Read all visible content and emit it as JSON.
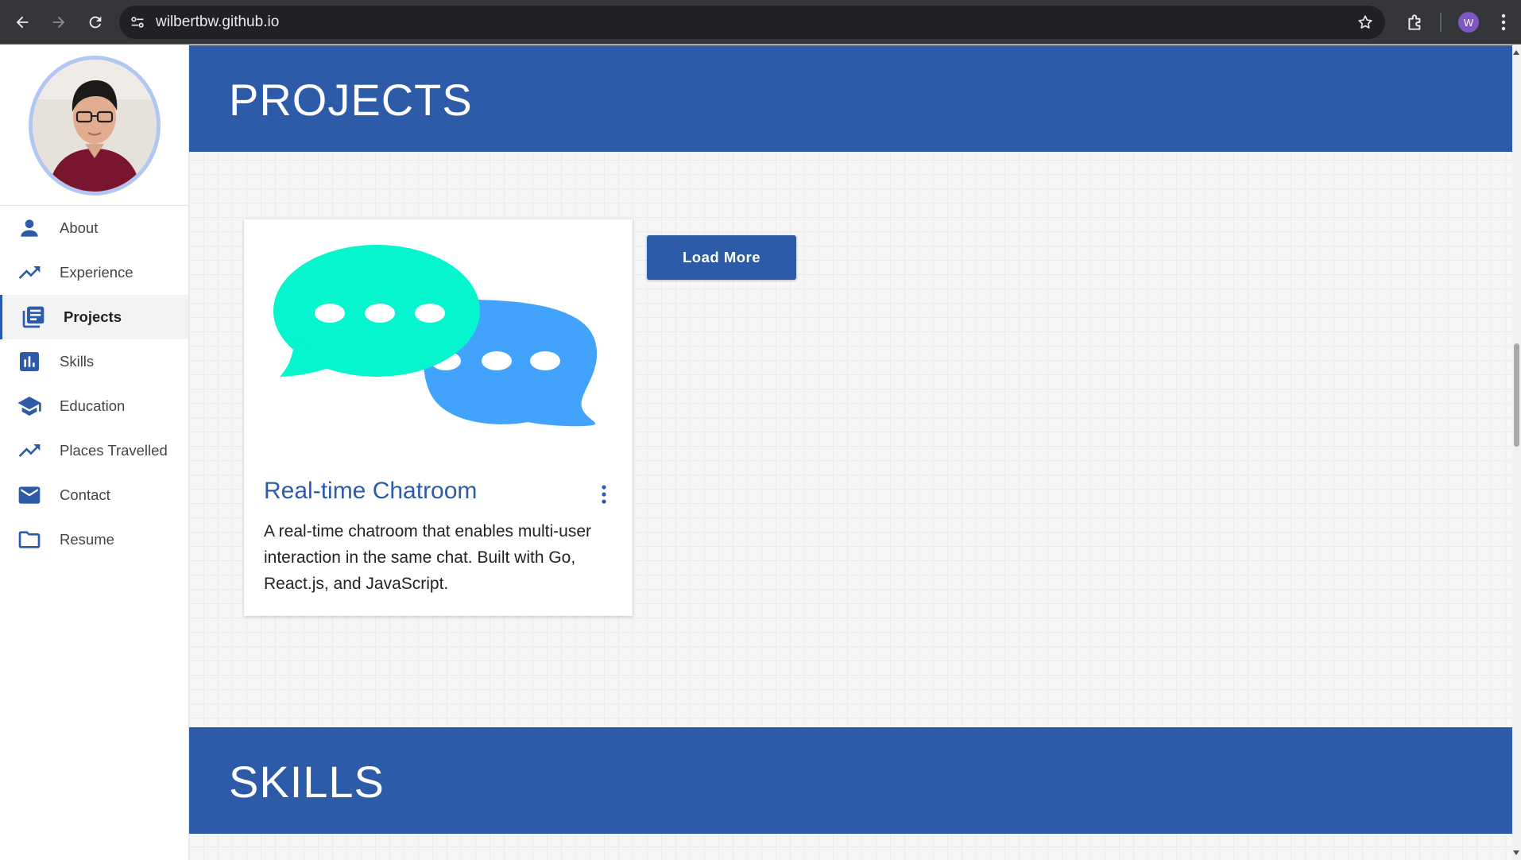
{
  "browser": {
    "url": "wilbertbw.github.io",
    "profile_initial": "W"
  },
  "sidebar": {
    "items": [
      {
        "label": "About",
        "icon": "person-icon"
      },
      {
        "label": "Experience",
        "icon": "trending-up-icon"
      },
      {
        "label": "Projects",
        "icon": "library-books-icon",
        "active": true
      },
      {
        "label": "Skills",
        "icon": "bar-chart-icon"
      },
      {
        "label": "Education",
        "icon": "school-icon"
      },
      {
        "label": "Places Travelled",
        "icon": "trending-up-icon"
      },
      {
        "label": "Contact",
        "icon": "mail-icon"
      },
      {
        "label": "Resume",
        "icon": "folder-icon"
      }
    ]
  },
  "projects": {
    "heading": "PROJECTS",
    "card": {
      "title": "Real-time Chatroom",
      "description": "A real-time chatroom that enables multi-user interaction in the same chat. Built with Go, React.js, and JavaScript.",
      "image_icon": "chat-bubbles-icon"
    },
    "load_more_label": "Load More"
  },
  "skills": {
    "heading": "SKILLS"
  },
  "colors": {
    "primary": "#2d5ba8",
    "chat_bubble_green": "#05f5cf",
    "chat_bubble_blue": "#42a3fc",
    "avatar_ring": "#b2c6f3"
  }
}
